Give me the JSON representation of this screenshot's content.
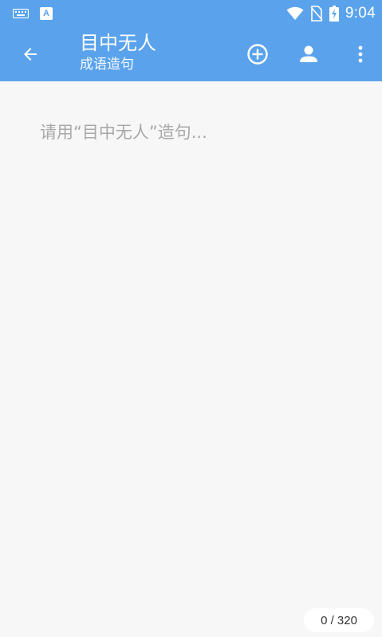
{
  "status_bar": {
    "time": "9:04",
    "icons": [
      "keyboard-icon",
      "a-letter-icon",
      "wifi-icon",
      "no-sim-icon",
      "battery-charging-icon"
    ],
    "a_icon_text": "A"
  },
  "app_bar": {
    "title": "目中无人",
    "subtitle": "成语造句",
    "actions": [
      "back-arrow-icon",
      "add-circle-icon",
      "person-icon",
      "more-vert-icon"
    ]
  },
  "editor": {
    "value": "",
    "placeholder": "请用“目中无人”造句..."
  },
  "counter": {
    "text": "0 / 320"
  },
  "colors": {
    "primary": "#5aa3ec",
    "background": "#f7f7f7",
    "placeholder": "#a8a8a8",
    "counter_bg": "#ffffff"
  }
}
